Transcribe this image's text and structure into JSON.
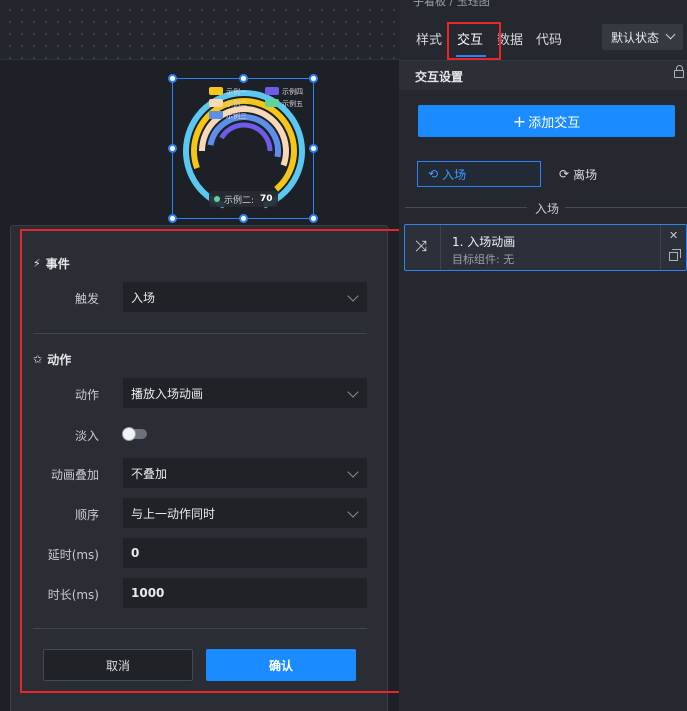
{
  "canvas": {
    "chart_data": {
      "type": "pie",
      "legend": [
        "示例一",
        "示例二",
        "示例三",
        "示例四",
        "示例五"
      ],
      "tooltip": {
        "series": "示例二:",
        "value": "70"
      },
      "colors": [
        "#5ac8f0",
        "#f5c518",
        "#f7d9b8",
        "#5d8fe8",
        "#6c5ce7",
        "#5ed39a"
      ]
    }
  },
  "dialog": {
    "event_section": {
      "title": "事件",
      "trigger_label": "触发",
      "trigger_value": "入场"
    },
    "action_section": {
      "title": "动作",
      "action_label": "动作",
      "action_value": "播放入场动画",
      "fade_label": "淡入",
      "overlay_label": "动画叠加",
      "overlay_value": "不叠加",
      "order_label": "顺序",
      "order_value": "与上一动作同时",
      "delay_label": "延时(ms)",
      "delay_value": "0",
      "duration_label": "时长(ms)",
      "duration_value": "1000"
    },
    "cancel_label": "取消",
    "confirm_label": "确认"
  },
  "panel": {
    "breadcrumb": "子看板 / 玉珏图",
    "tabs": [
      "样式",
      "交互",
      "数据",
      "代码"
    ],
    "state_select": "默认状态",
    "section_title": "交互设置",
    "add_button": "添加交互",
    "phase_in": "入场",
    "phase_out": "离场",
    "separator_label": "入场",
    "interaction_card": {
      "title": "1. 入场动画",
      "subtitle": "目标组件: 无"
    }
  }
}
